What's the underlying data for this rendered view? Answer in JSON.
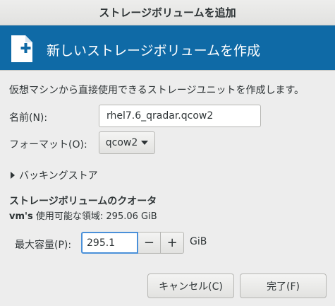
{
  "window": {
    "title": "ストレージボリュームを追加"
  },
  "header": {
    "title": "新しいストレージボリュームを作成",
    "icon": "new-document-icon"
  },
  "description": "仮想マシンから直接使用できるストレージユニットを作成します。",
  "form": {
    "name_label": "名前(N):",
    "name_value": "rhel7.6_qradar.qcow2",
    "format_label": "フォーマット(O):",
    "format_value": "qcow2",
    "backing_store_label": "バッキングストア"
  },
  "quota": {
    "title": "ストレージボリュームのクオータ",
    "pool_name": "vm's",
    "available_text": "使用可能な領域: 295.06 GiB",
    "max_capacity_label": "最大容量(P):",
    "max_capacity_value": "295.1",
    "decrement": "−",
    "increment": "+",
    "unit": "GiB"
  },
  "buttons": {
    "cancel": "キャンセル(C)",
    "finish": "完了(F)"
  },
  "colors": {
    "header_bg": "#0f6aa6",
    "focus_border": "#4a90d9"
  }
}
